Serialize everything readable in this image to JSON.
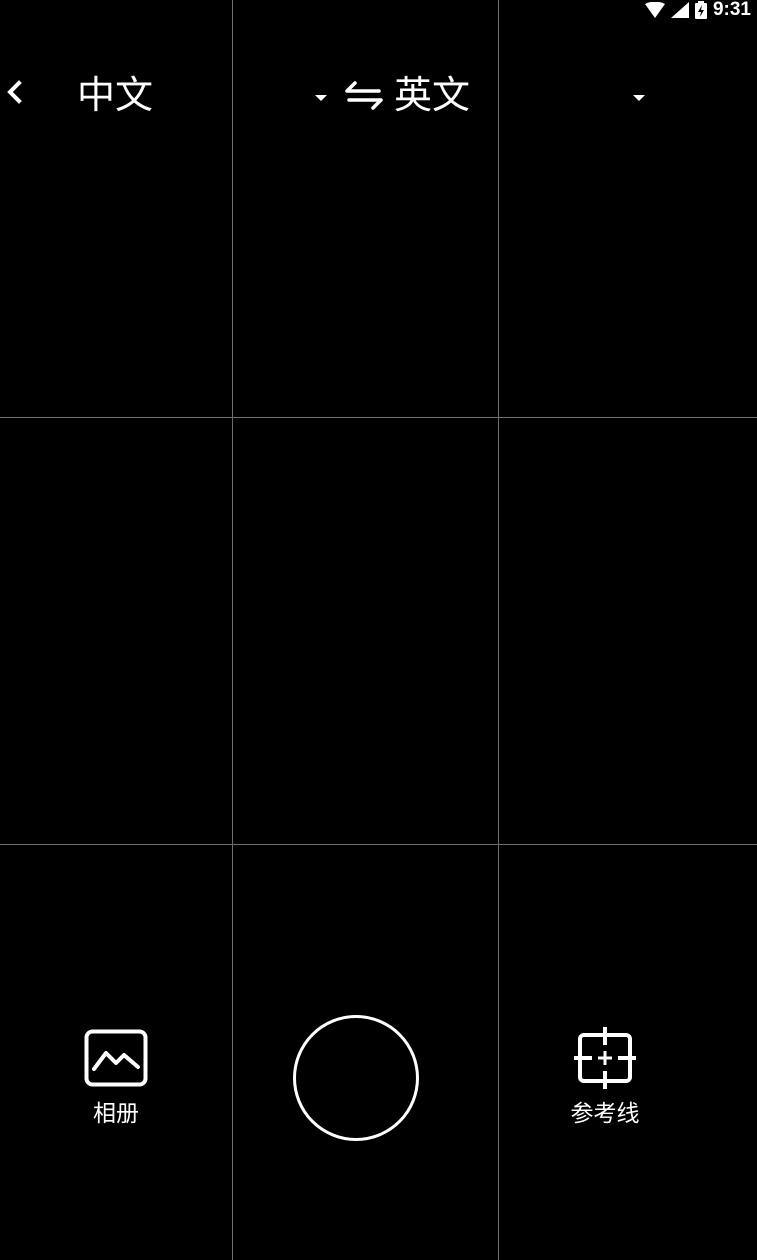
{
  "status_bar": {
    "time": "9:31",
    "icons": [
      "wifi-icon",
      "signal-icon",
      "battery-charging-icon"
    ]
  },
  "toolbar": {
    "back_icon": "chevron-left-icon",
    "source_language": "中文",
    "swap_icon": "swap-arrows-icon",
    "target_language": "英文",
    "dropdown_icon": "caret-down-icon"
  },
  "bottom_controls": {
    "album_label": "相册",
    "album_icon": "photo-album-icon",
    "shutter_icon": "shutter-circle-icon",
    "guide_label": "参考线",
    "guide_icon": "grid-crosshair-icon"
  },
  "colors": {
    "background": "#000000",
    "foreground": "#ffffff",
    "grid_line": "#6f6f6f"
  }
}
